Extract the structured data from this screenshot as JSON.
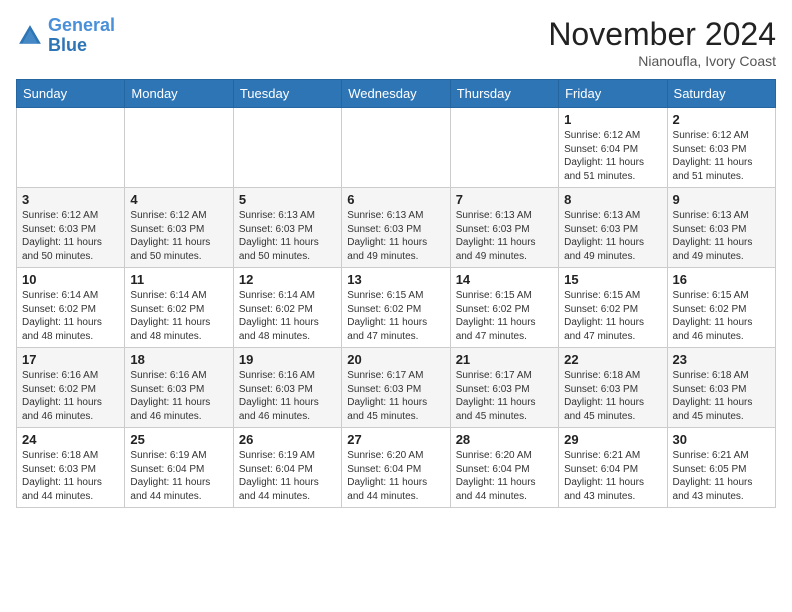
{
  "logo": {
    "line1": "General",
    "line2": "Blue"
  },
  "title": "November 2024",
  "location": "Nianoufla, Ivory Coast",
  "days_of_week": [
    "Sunday",
    "Monday",
    "Tuesday",
    "Wednesday",
    "Thursday",
    "Friday",
    "Saturday"
  ],
  "weeks": [
    [
      {
        "day": "",
        "info": ""
      },
      {
        "day": "",
        "info": ""
      },
      {
        "day": "",
        "info": ""
      },
      {
        "day": "",
        "info": ""
      },
      {
        "day": "",
        "info": ""
      },
      {
        "day": "1",
        "info": "Sunrise: 6:12 AM\nSunset: 6:04 PM\nDaylight: 11 hours\nand 51 minutes."
      },
      {
        "day": "2",
        "info": "Sunrise: 6:12 AM\nSunset: 6:03 PM\nDaylight: 11 hours\nand 51 minutes."
      }
    ],
    [
      {
        "day": "3",
        "info": "Sunrise: 6:12 AM\nSunset: 6:03 PM\nDaylight: 11 hours\nand 50 minutes."
      },
      {
        "day": "4",
        "info": "Sunrise: 6:12 AM\nSunset: 6:03 PM\nDaylight: 11 hours\nand 50 minutes."
      },
      {
        "day": "5",
        "info": "Sunrise: 6:13 AM\nSunset: 6:03 PM\nDaylight: 11 hours\nand 50 minutes."
      },
      {
        "day": "6",
        "info": "Sunrise: 6:13 AM\nSunset: 6:03 PM\nDaylight: 11 hours\nand 49 minutes."
      },
      {
        "day": "7",
        "info": "Sunrise: 6:13 AM\nSunset: 6:03 PM\nDaylight: 11 hours\nand 49 minutes."
      },
      {
        "day": "8",
        "info": "Sunrise: 6:13 AM\nSunset: 6:03 PM\nDaylight: 11 hours\nand 49 minutes."
      },
      {
        "day": "9",
        "info": "Sunrise: 6:13 AM\nSunset: 6:03 PM\nDaylight: 11 hours\nand 49 minutes."
      }
    ],
    [
      {
        "day": "10",
        "info": "Sunrise: 6:14 AM\nSunset: 6:02 PM\nDaylight: 11 hours\nand 48 minutes."
      },
      {
        "day": "11",
        "info": "Sunrise: 6:14 AM\nSunset: 6:02 PM\nDaylight: 11 hours\nand 48 minutes."
      },
      {
        "day": "12",
        "info": "Sunrise: 6:14 AM\nSunset: 6:02 PM\nDaylight: 11 hours\nand 48 minutes."
      },
      {
        "day": "13",
        "info": "Sunrise: 6:15 AM\nSunset: 6:02 PM\nDaylight: 11 hours\nand 47 minutes."
      },
      {
        "day": "14",
        "info": "Sunrise: 6:15 AM\nSunset: 6:02 PM\nDaylight: 11 hours\nand 47 minutes."
      },
      {
        "day": "15",
        "info": "Sunrise: 6:15 AM\nSunset: 6:02 PM\nDaylight: 11 hours\nand 47 minutes."
      },
      {
        "day": "16",
        "info": "Sunrise: 6:15 AM\nSunset: 6:02 PM\nDaylight: 11 hours\nand 46 minutes."
      }
    ],
    [
      {
        "day": "17",
        "info": "Sunrise: 6:16 AM\nSunset: 6:02 PM\nDaylight: 11 hours\nand 46 minutes."
      },
      {
        "day": "18",
        "info": "Sunrise: 6:16 AM\nSunset: 6:03 PM\nDaylight: 11 hours\nand 46 minutes."
      },
      {
        "day": "19",
        "info": "Sunrise: 6:16 AM\nSunset: 6:03 PM\nDaylight: 11 hours\nand 46 minutes."
      },
      {
        "day": "20",
        "info": "Sunrise: 6:17 AM\nSunset: 6:03 PM\nDaylight: 11 hours\nand 45 minutes."
      },
      {
        "day": "21",
        "info": "Sunrise: 6:17 AM\nSunset: 6:03 PM\nDaylight: 11 hours\nand 45 minutes."
      },
      {
        "day": "22",
        "info": "Sunrise: 6:18 AM\nSunset: 6:03 PM\nDaylight: 11 hours\nand 45 minutes."
      },
      {
        "day": "23",
        "info": "Sunrise: 6:18 AM\nSunset: 6:03 PM\nDaylight: 11 hours\nand 45 minutes."
      }
    ],
    [
      {
        "day": "24",
        "info": "Sunrise: 6:18 AM\nSunset: 6:03 PM\nDaylight: 11 hours\nand 44 minutes."
      },
      {
        "day": "25",
        "info": "Sunrise: 6:19 AM\nSunset: 6:04 PM\nDaylight: 11 hours\nand 44 minutes."
      },
      {
        "day": "26",
        "info": "Sunrise: 6:19 AM\nSunset: 6:04 PM\nDaylight: 11 hours\nand 44 minutes."
      },
      {
        "day": "27",
        "info": "Sunrise: 6:20 AM\nSunset: 6:04 PM\nDaylight: 11 hours\nand 44 minutes."
      },
      {
        "day": "28",
        "info": "Sunrise: 6:20 AM\nSunset: 6:04 PM\nDaylight: 11 hours\nand 44 minutes."
      },
      {
        "day": "29",
        "info": "Sunrise: 6:21 AM\nSunset: 6:04 PM\nDaylight: 11 hours\nand 43 minutes."
      },
      {
        "day": "30",
        "info": "Sunrise: 6:21 AM\nSunset: 6:05 PM\nDaylight: 11 hours\nand 43 minutes."
      }
    ]
  ]
}
